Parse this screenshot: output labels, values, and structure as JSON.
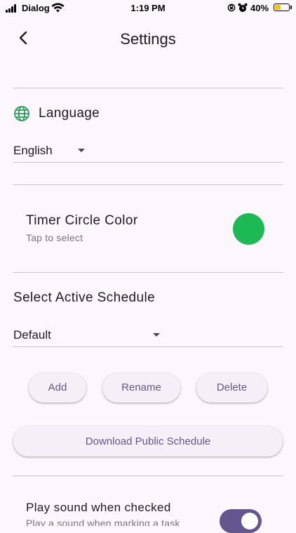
{
  "status_bar": {
    "carrier": "Dialog",
    "time": "1:19 PM",
    "battery_percent": "40%",
    "battery_level": 0.4,
    "icons": [
      "signal-icon",
      "wifi-icon",
      "orientation-lock-icon",
      "alarm-icon",
      "battery-icon"
    ]
  },
  "app_bar": {
    "title": "Settings",
    "back_icon": "back-arrow-icon"
  },
  "language": {
    "icon": "globe-icon",
    "icon_color": "#2e9d5b",
    "title": "Language",
    "selected": "English"
  },
  "timer_color": {
    "title": "Timer Circle Color",
    "subtitle": "Tap to select",
    "selected_color": "#1db954"
  },
  "schedule": {
    "title": "Select Active Schedule",
    "selected": "Default",
    "buttons": {
      "add": "Add",
      "rename": "Rename",
      "delete": "Delete",
      "download": "Download Public Schedule"
    }
  },
  "sound": {
    "title": "Play sound when checked",
    "subtitle": "Play a sound when marking a task",
    "enabled": true
  },
  "colors": {
    "background": "#fcf7fd",
    "accent": "#65558f",
    "divider": "#cac4d0"
  }
}
